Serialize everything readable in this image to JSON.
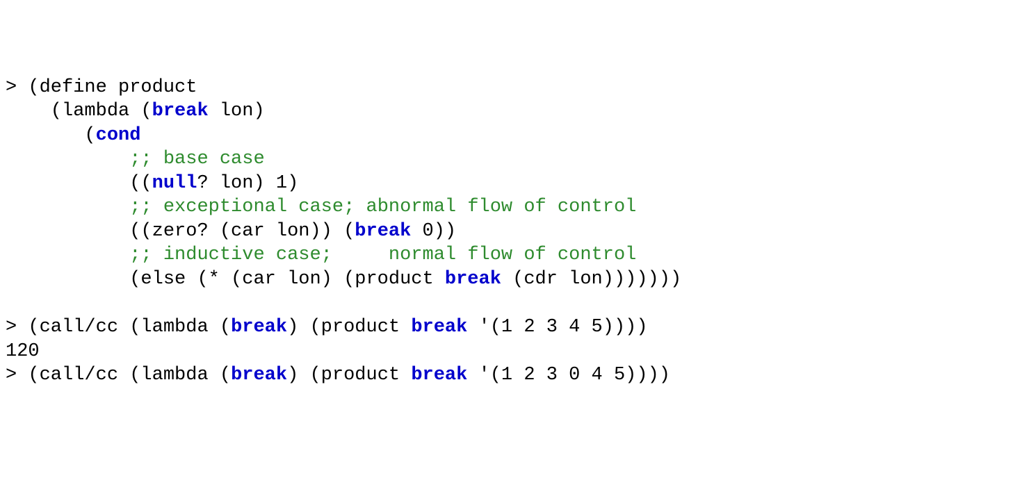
{
  "chart_data": null,
  "code": {
    "l1": {
      "a": "> (define product"
    },
    "l2": {
      "a": "    (lambda (",
      "b": "break",
      "c": " lon)"
    },
    "l3": {
      "a": "       (",
      "b": "cond",
      "c": ""
    },
    "l4": {
      "a": "           ",
      "b": ";; base case"
    },
    "l5": {
      "a": "           ((",
      "b": "null",
      "c": "? lon) 1)"
    },
    "l6": {
      "a": "           ",
      "b": ";; exceptional case; abnormal flow of control"
    },
    "l7": {
      "a": "           ((zero? (car lon)) (",
      "b": "break",
      "c": " 0))"
    },
    "l8": {
      "a": "           ",
      "b": ";; inductive case;     normal flow of control"
    },
    "l9": {
      "a": "           (else (* (car lon) (product ",
      "b": "break",
      "c": " (cdr lon)))))))"
    },
    "l10": {
      "a": ""
    },
    "l11": {
      "a": "> (call/cc (lambda (",
      "b": "break",
      "c": ") (product ",
      "d": "break",
      "e": " '(1 2 3 4 5))))"
    },
    "l12": {
      "a": "120"
    },
    "l13": {
      "a": "> (call/cc (lambda (",
      "b": "break",
      "c": ") (product ",
      "d": "break",
      "e": " '(1 2 3 0 4 5))))"
    }
  }
}
